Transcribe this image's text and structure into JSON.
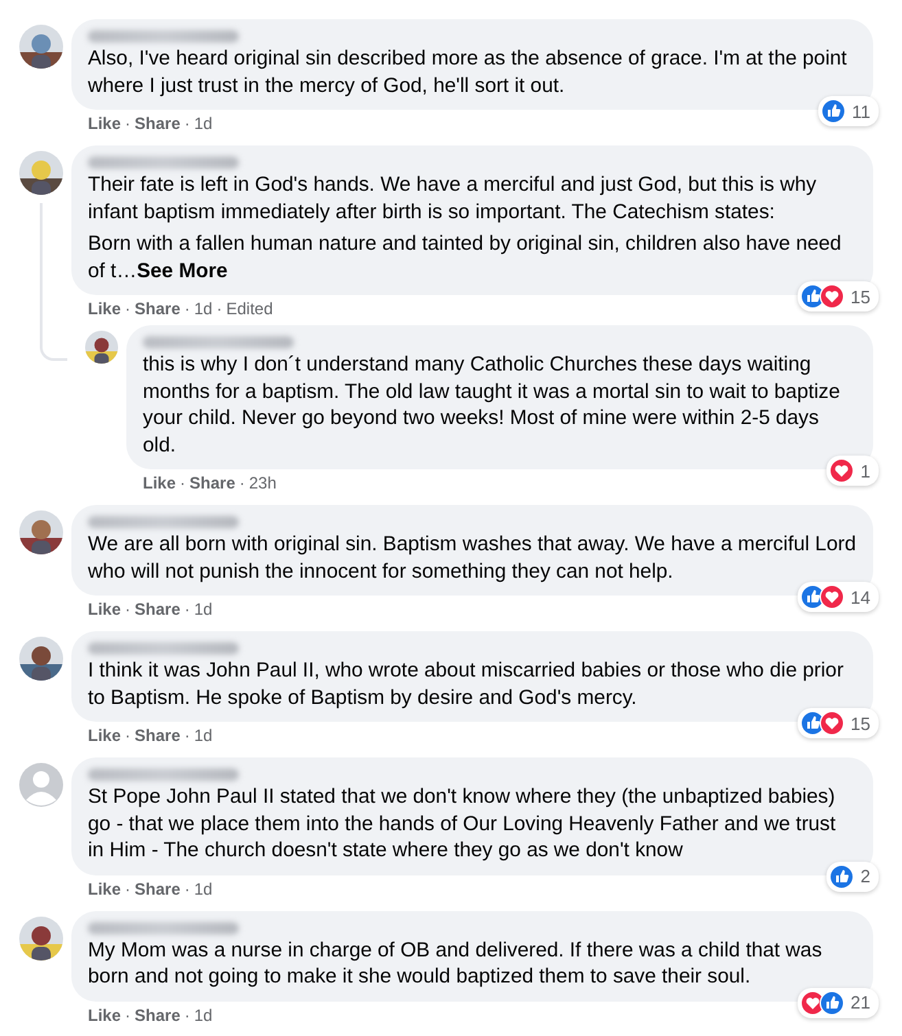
{
  "separator": "·",
  "comments": [
    {
      "avatar": {
        "kind": "picture"
      },
      "paragraphs": [
        {
          "text": "Also, I've heard original sin described more as the absence of grace. I'm at the point where I just trust in the mercy of God, he'll sort it out."
        }
      ],
      "actions": [
        "Like",
        "Share"
      ],
      "time": "1d",
      "reactions": [
        {
          "kind": "like"
        }
      ],
      "reaction_count": "11"
    },
    {
      "avatar": {
        "kind": "picture"
      },
      "paragraphs": [
        {
          "text": "Their fate is left in God's hands. We have a merciful and just God, but this is why infant baptism immediately after birth is so important. The Catechism states:"
        },
        {
          "text": "Born with a fallen human nature and tainted by original sin, children also have need of t…",
          "see_more": "See More"
        }
      ],
      "actions": [
        "Like",
        "Share"
      ],
      "time": "1d",
      "edited": "Edited",
      "reactions": [
        {
          "kind": "like"
        },
        {
          "kind": "love"
        }
      ],
      "reaction_count": "15",
      "replies": [
        {
          "avatar": {
            "kind": "picture"
          },
          "paragraphs": [
            {
              "text": "this is why I don´t understand many Catholic Churches these days waiting months for a baptism. The old law taught it was a mortal sin to wait to baptize your child. Never go beyond two weeks! Most of mine were within 2-5 days old."
            }
          ],
          "actions": [
            "Like",
            "Share"
          ],
          "time": "23h",
          "reactions": [
            {
              "kind": "love"
            }
          ],
          "reaction_count": "1"
        }
      ]
    },
    {
      "avatar": {
        "kind": "picture"
      },
      "paragraphs": [
        {
          "text": "We are all born with original sin. Baptism washes that away. We have a merciful Lord who will not punish the innocent for something they can not help."
        }
      ],
      "actions": [
        "Like",
        "Share"
      ],
      "time": "1d",
      "reactions": [
        {
          "kind": "like"
        },
        {
          "kind": "love"
        }
      ],
      "reaction_count": "14"
    },
    {
      "avatar": {
        "kind": "picture"
      },
      "paragraphs": [
        {
          "text": "I think it was John Paul II, who wrote about miscarried babies or those who die prior to Baptism. He spoke of Baptism by desire and God's mercy."
        }
      ],
      "actions": [
        "Like",
        "Share"
      ],
      "time": "1d",
      "reactions": [
        {
          "kind": "like"
        },
        {
          "kind": "love"
        }
      ],
      "reaction_count": "15"
    },
    {
      "avatar": {
        "kind": "default"
      },
      "paragraphs": [
        {
          "text": "St Pope John Paul II stated that we don't know where they (the unbaptized babies) go - that we place them into the hands of Our Loving Heavenly Father and we trust in Him - The church doesn't state where they go as we don't know"
        }
      ],
      "actions": [
        "Like",
        "Share"
      ],
      "time": "1d",
      "reactions": [
        {
          "kind": "like"
        }
      ],
      "reaction_count": "2"
    },
    {
      "avatar": {
        "kind": "picture"
      },
      "paragraphs": [
        {
          "text": "My Mom was a nurse in charge of OB and delivered. If there was a child that was born and not going to make it she would baptized them to save their soul."
        }
      ],
      "actions": [
        "Like",
        "Share"
      ],
      "time": "1d",
      "reactions": [
        {
          "kind": "love"
        },
        {
          "kind": "like"
        }
      ],
      "reaction_count": "21"
    }
  ]
}
